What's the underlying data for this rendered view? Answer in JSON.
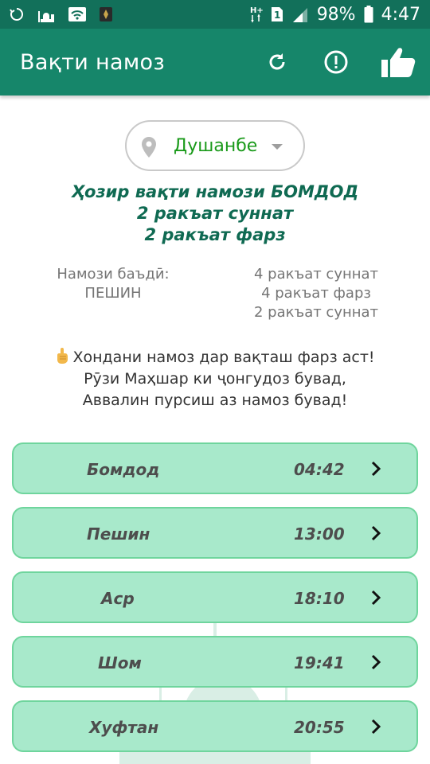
{
  "status": {
    "battery": "98%",
    "time": "4:47",
    "network": "H+"
  },
  "app": {
    "title": "Вақти намоз"
  },
  "city": {
    "name": "Душанбе"
  },
  "current": {
    "line1": "Ҳозир вақти намози БОМДОД",
    "line2": "2 ракъат суннат",
    "line3": "2 ракъат фарз"
  },
  "next": {
    "label": "Намози баъдӣ:",
    "name": "ПЕШИН",
    "rakat1": "4 ракъат суннат",
    "rakat2": "4 ракъат фарз",
    "rakat3": "2 ракъат суннат"
  },
  "quote": {
    "line1": "Хондани намоз дар вақташ фарз аст!",
    "line2": "Рӯзи Маҳшар ки ҷонгудоз бувад,",
    "line3": "Аввалин пурсиш аз намоз бувад!"
  },
  "prayers": [
    {
      "name": "Бомдод",
      "time": "04:42"
    },
    {
      "name": "Пешин",
      "time": "13:00"
    },
    {
      "name": "Аср",
      "time": "18:10"
    },
    {
      "name": "Шом",
      "time": "19:41"
    },
    {
      "name": "Хуфтан",
      "time": "20:55"
    }
  ],
  "colors": {
    "status_bar": "#12705a",
    "app_bar": "#16866a",
    "city_text": "#1a9a1a",
    "current_text": "#0f6a52",
    "prayer_bg": "#a8e9cb",
    "prayer_border": "#6fd59d"
  },
  "icons": {
    "refresh": "refresh-icon",
    "info": "exclamation-circle-icon",
    "like": "thumbs-up-icon",
    "location": "location-pin-icon",
    "dropdown": "caret-down-icon",
    "chevron": "chevron-right-icon",
    "finger": "pointing-up-finger-icon"
  }
}
